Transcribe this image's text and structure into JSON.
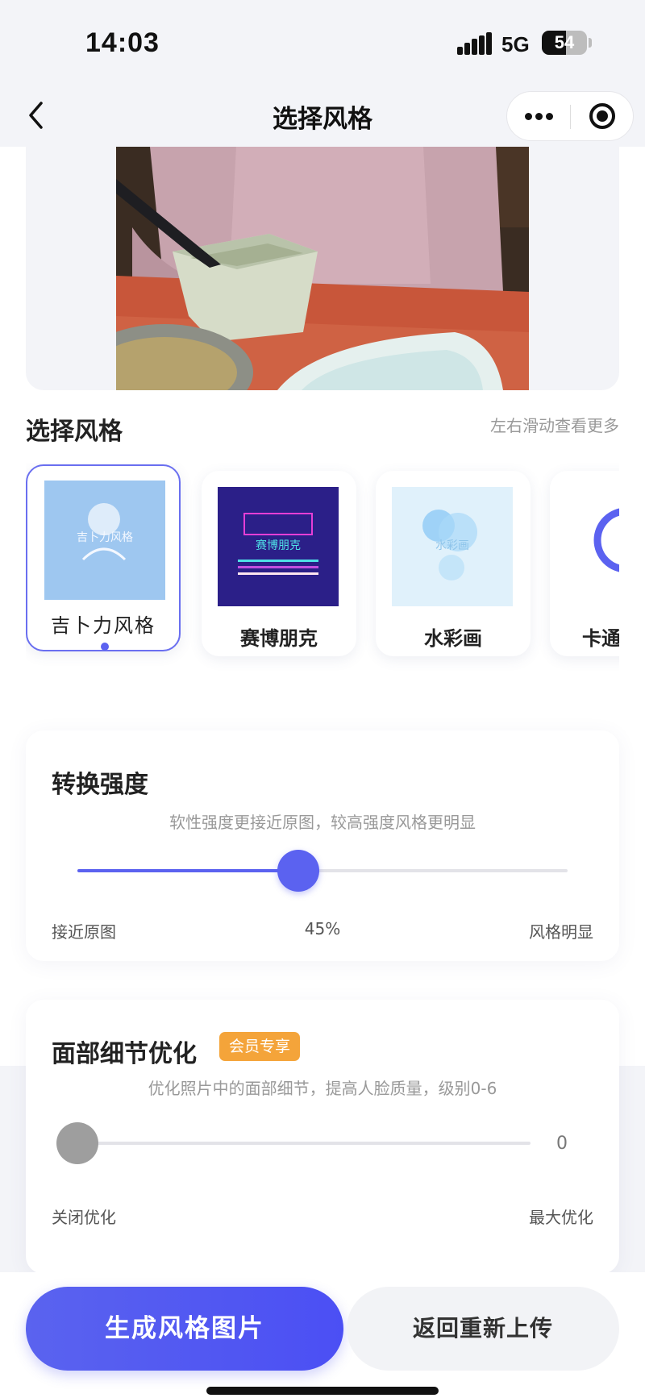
{
  "status_bar": {
    "time": "14:03",
    "network": "5G",
    "battery": "54",
    "battery_level": 0.54
  },
  "nav": {
    "title": "选择风格",
    "back_icon": "chevron-left-icon",
    "more_icon": "more-dots-icon",
    "close_icon": "target-circle-icon"
  },
  "styles": {
    "section_title": "选择风格",
    "swipe_hint": "左右滑动查看更多",
    "items": [
      {
        "label": "吉卜力风格",
        "thumb_text": "吉卜力风格",
        "selected": true
      },
      {
        "label": "赛博朋克",
        "thumb_text": "赛博朋克",
        "selected": false
      },
      {
        "label": "水彩画",
        "thumb_text": "水彩画",
        "selected": false
      },
      {
        "label": "卡通",
        "selected": false
      }
    ]
  },
  "strength": {
    "title": "转换强度",
    "description": "软性强度更接近原图，较高强度风格更明显",
    "value_label": "45%",
    "value": 0.45,
    "min_label": "接近原图",
    "max_label": "风格明显"
  },
  "face": {
    "title": "面部细节优化",
    "badge": "会员专享",
    "description": "优化照片中的面部细节，提高人脸质量，级别0-6",
    "value": "0",
    "level": 0,
    "min_label": "关闭优化",
    "max_label": "最大优化"
  },
  "actions": {
    "generate": "生成风格图片",
    "reupload": "返回重新上传"
  },
  "colors": {
    "accent": "#5b62f0",
    "badge": "#f4a43a",
    "knob_disabled": "#9e9e9e"
  }
}
